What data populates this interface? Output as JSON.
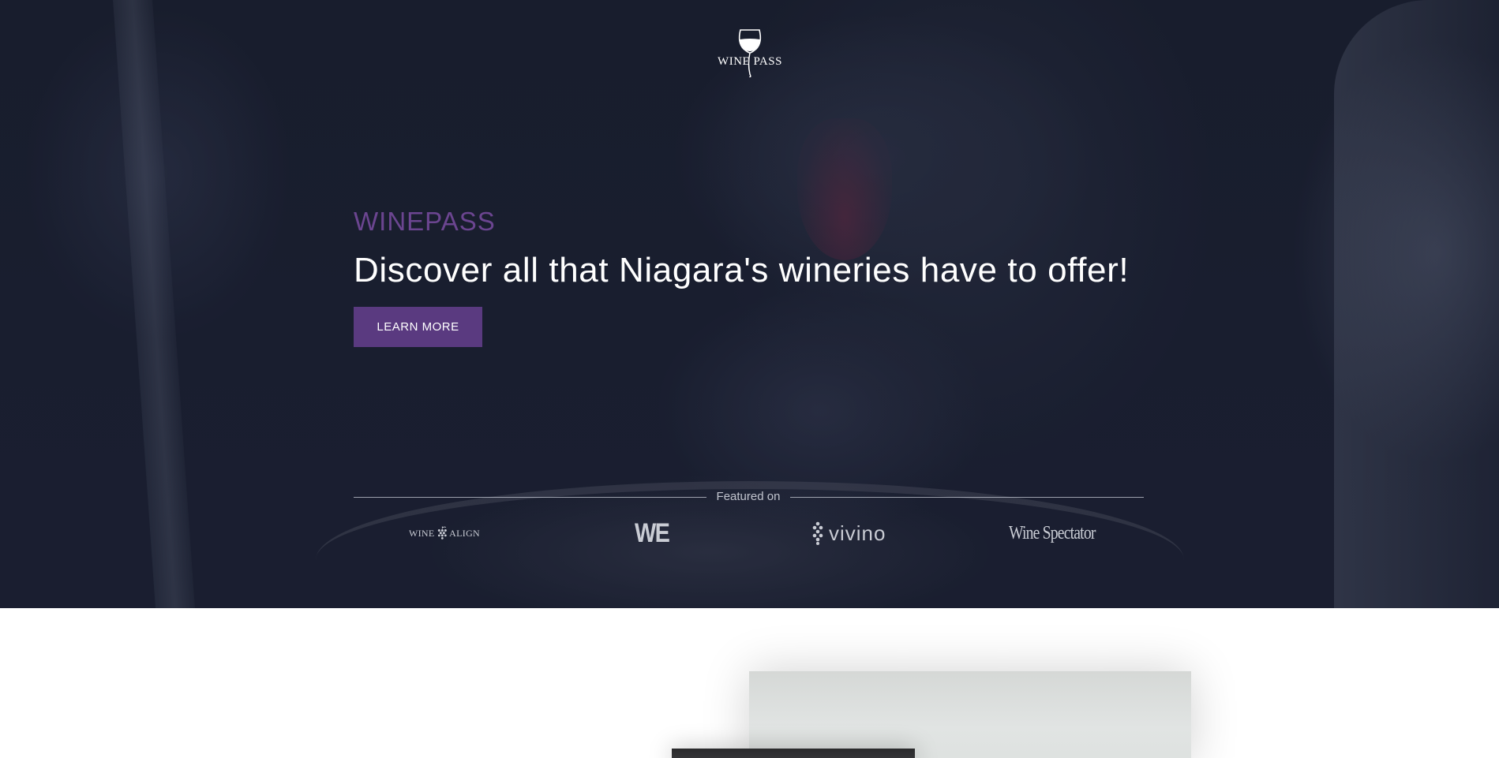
{
  "brand": {
    "logo_text": "WINE PASS",
    "accent_color": "#5a3a80",
    "eyebrow_color": "#6b4590"
  },
  "hero": {
    "eyebrow": "WINEPASS",
    "headline": "Discover all that Niagara's wineries have to offer!",
    "cta_label": "LEARN MORE"
  },
  "featured": {
    "label": "Featured on",
    "logos": [
      {
        "text": "WINE ALIGN",
        "icon": "grape-cluster-icon"
      },
      {
        "text": "WE"
      },
      {
        "text": "vivino",
        "icon": "grape-dots-icon"
      },
      {
        "text": "Wine Spectator"
      }
    ]
  }
}
